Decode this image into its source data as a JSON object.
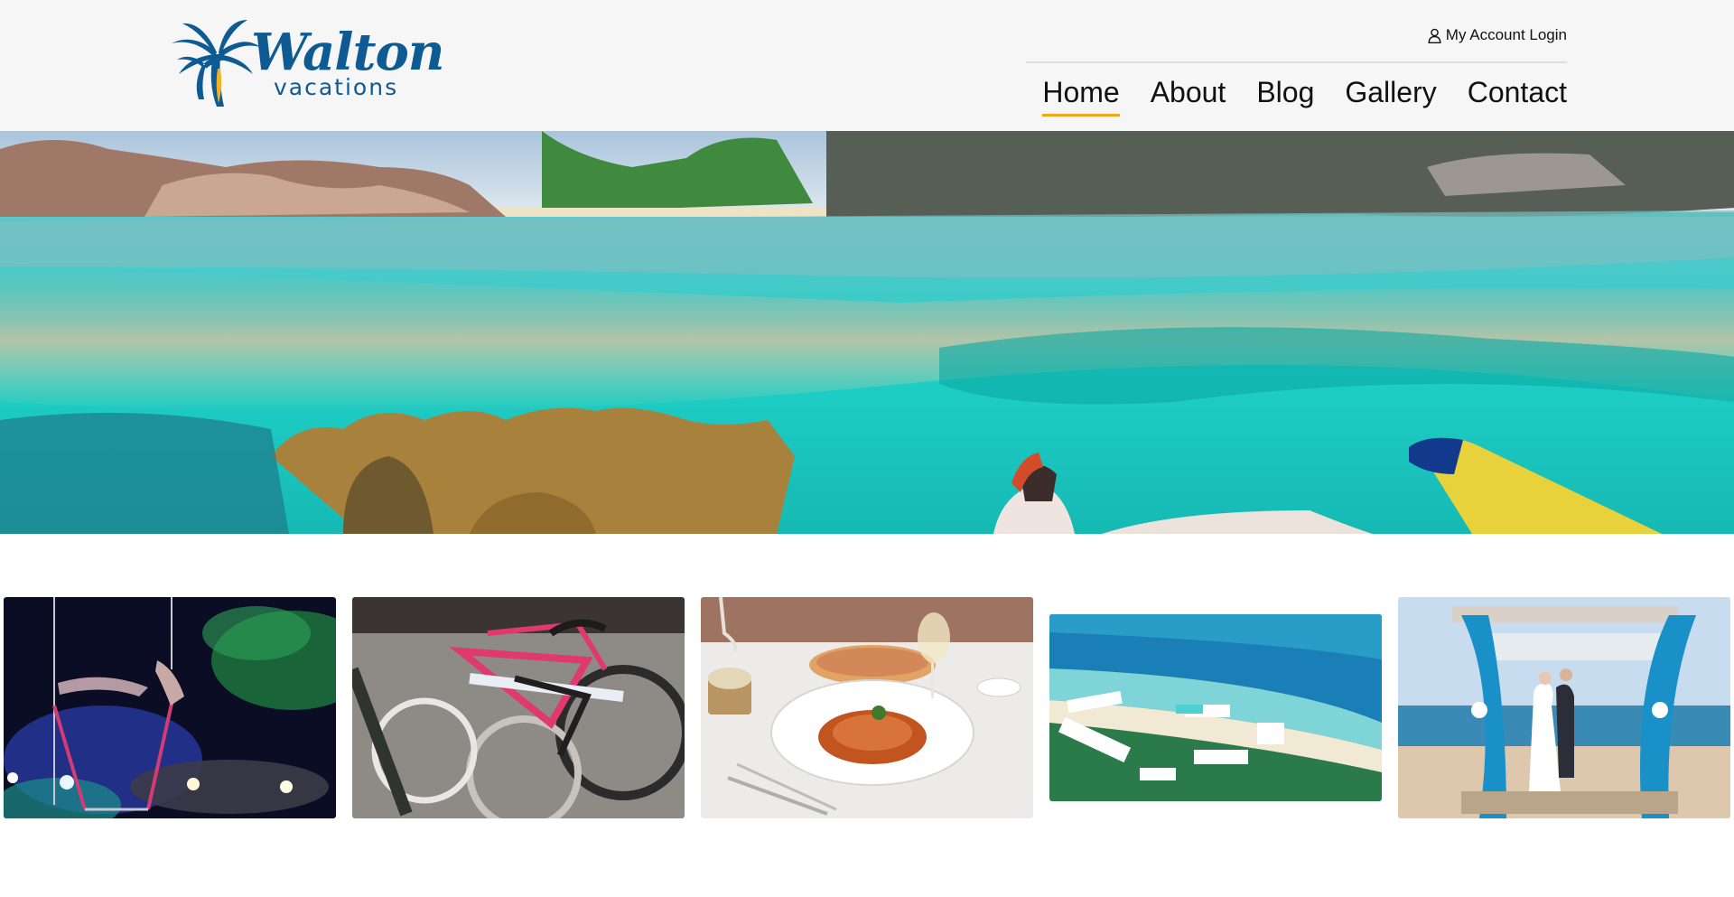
{
  "brand": {
    "name": "Walton",
    "tagline": "vacations",
    "colors": {
      "primary": "#0e5a93",
      "accent": "#f0a814"
    }
  },
  "header": {
    "account_icon": "user-icon",
    "account_login": "My Account Login"
  },
  "nav": {
    "items": [
      {
        "label": "Home",
        "active": true
      },
      {
        "label": "About",
        "active": false
      },
      {
        "label": "Blog",
        "active": false
      },
      {
        "label": "Gallery",
        "active": false
      },
      {
        "label": "Contact",
        "active": false
      }
    ]
  },
  "hero": {
    "image": "snorkeler-under-turquoise-water-near-coral-and-boulders"
  },
  "gallery": {
    "images": [
      "aerial-acrobats-on-stage-with-colored-lights",
      "row-of-beach-cruiser-bicycles",
      "spaghetti-dinner-with-wine",
      "aerial-view-of-beach-resort",
      "beach-wedding-gazebo-with-blue-drapes"
    ]
  }
}
